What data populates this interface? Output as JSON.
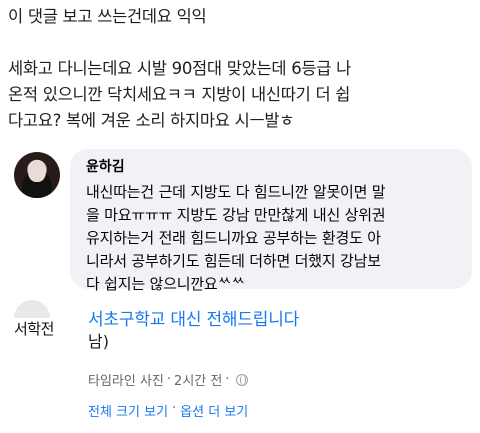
{
  "post": {
    "line1": "이 댓글 보고 쓰는건데요 익익",
    "line2": "세화고 다니는데요 시발 90점대 맞았는데 6등급 나\n온적 있으니깐 닥치세요ㅋㅋ 지방이 내신따기 더 쉽\n다고요? 복에 겨운 소리 하지마요 시ㅡ발ㅎ"
  },
  "comment": {
    "author": "윤하김",
    "body": "내신따는건 근데 지방도 다 힘드니깐 알못이면 말\n을 마요ㅠㅠㅠ 지방도 강남 만만찮게 내신 상위권\n유지하는거 전래 힘드니까요 공부하는 환경도 아\n니라서 공부하기도 힘든데 더하면 더했지 강남보\n다 쉽지는 않으니깐요ᄿᄿ"
  },
  "page": {
    "logo_text": "서학전",
    "name": "서초구학교 대신 전해드립니다",
    "tag": "남)",
    "meta_timeline": "타임라인 사진",
    "meta_sep": "·",
    "meta_time": "2시간 전",
    "meta_dot": "·",
    "action_full": "전체 크기 보기",
    "action_sep": "·",
    "action_more": "옵션 더 보기"
  },
  "icons": {
    "avatar": "profile-photo",
    "privacy": "globe-icon"
  },
  "colors": {
    "link": "#1877f2",
    "bubble": "#f0f2f5",
    "meta": "#65676b"
  }
}
